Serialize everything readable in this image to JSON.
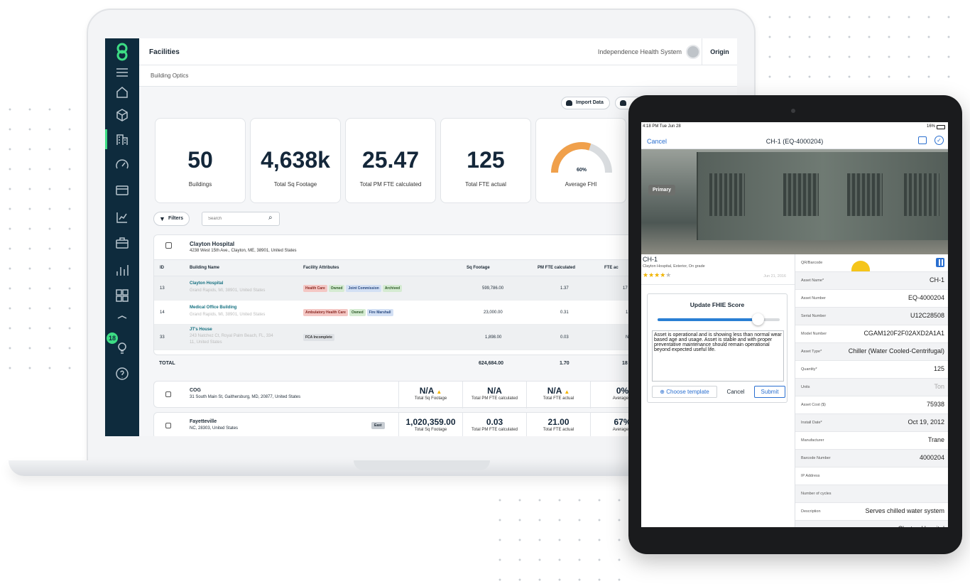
{
  "laptop": {
    "topbar": {
      "title": "Facilities",
      "org": "Independence Health System",
      "origin": "Origin"
    },
    "subbar": {
      "label": "Building Optics"
    },
    "actions": {
      "import": "Import Data"
    },
    "cards": [
      {
        "value": "50",
        "label": "Buildings"
      },
      {
        "value": "4,638k",
        "label": "Total Sq Footage"
      },
      {
        "value": "25.47",
        "label": "Total PM FTE calculated"
      },
      {
        "value": "125",
        "label": "Total FTE actual"
      },
      {
        "value": "60%",
        "label": "Average FHI",
        "gauge_fraction": 0.6
      }
    ],
    "filters": {
      "label": "Filters",
      "search_placeholder": "Search"
    },
    "sidebar": {
      "badge": "18"
    },
    "group1": {
      "name": "Clayton Hospital",
      "address": "4238 West 15th Ave., Clayton, ME, 38901, United States",
      "columns": [
        "ID",
        "Building Name",
        "Facility Attributes",
        "Sq Footage",
        "PM FTE calculated",
        "FTE ac"
      ],
      "rows": [
        {
          "id": "13",
          "name": "Clayton Hospital",
          "addr": "Grand Rapids, MI, 38901, United States",
          "tags": [
            "Health Care",
            "Owned",
            "Joint Commission",
            "Archived"
          ],
          "sq": "599,786.00",
          "pm": "1.37",
          "fte": "17"
        },
        {
          "id": "14",
          "name": "Medical Office Building",
          "addr": "Grand Rapids, MI, 38901, United States",
          "tags": [
            "Ambulatory Health Care",
            "Owned",
            "Fire Marshall"
          ],
          "sq": "23,000.00",
          "pm": "0.31",
          "fte": "1."
        },
        {
          "id": "33",
          "name": "JT's House",
          "addr": "243 Natchez Ct, Royal Palm Beach, FL, 334",
          "addr2": "11, United States",
          "tags": [
            "FCA Incomplete"
          ],
          "sq": "1,898.00",
          "pm": "0.03",
          "fte": "N"
        }
      ],
      "total": {
        "label": "TOTAL",
        "sq": "624,684.00",
        "pm": "1.70",
        "fte": "18"
      }
    },
    "group2": {
      "name": "COG",
      "address": "31 South Main St, Gaithersburg, MD, 20877, United States",
      "metrics": [
        {
          "value": "N/A",
          "label": "Total Sq Footage"
        },
        {
          "value": "N/A",
          "label": "Total PM FTE calculated"
        },
        {
          "value": "N/A",
          "label": "Total FTE actual"
        },
        {
          "value": "0%",
          "label": "Average F"
        }
      ]
    },
    "group3": {
      "name": "Fayetteville",
      "address": "NC, 28303, United States",
      "tag": "East",
      "metrics": [
        {
          "value": "1,020,359.00",
          "label": "Total Sq Footage"
        },
        {
          "value": "0.03",
          "label": "Total PM FTE calculated"
        },
        {
          "value": "21.00",
          "label": "Total FTE actual"
        },
        {
          "value": "67%",
          "label": "Average F"
        }
      ]
    }
  },
  "tablet": {
    "status": {
      "time": "4:18 PM  Tue Jun 28",
      "battery": "16%"
    },
    "nav": {
      "cancel": "Cancel",
      "title": "CH-1 (EQ-4000204)"
    },
    "photo": {
      "badge": "Primary"
    },
    "asset": {
      "name": "CH-1",
      "sub": "Clayton Hospital, Exterior, On grade",
      "date": "Jun 21, 2016",
      "stars": "★★★★",
      "star_empty": "★",
      "rating": 4
    },
    "fhie": {
      "title": "Update FHIE Score",
      "slider_value": 0.82,
      "text": "Asset is operational and is showing less than normal wear based age and usage. Asset is stable and with proper preventative maintenance should remain operational beyond expected useful life.",
      "choose": "Choose template",
      "cancel": "Cancel",
      "submit": "Submit"
    },
    "fields": [
      {
        "k": "QR/Barcode",
        "v": ""
      },
      {
        "k": "Asset Name*",
        "v": "CH-1"
      },
      {
        "k": "Asset Number",
        "v": "EQ-4000204"
      },
      {
        "k": "Serial Number",
        "v": "U12C28508"
      },
      {
        "k": "Model Number",
        "v": "CGAM120F2F02AXD2A1A1"
      },
      {
        "k": "Asset Type*",
        "v": "Chiller (Water Cooled-Centrifugal)"
      },
      {
        "k": "Quantity*",
        "v": "125"
      },
      {
        "k": "Units",
        "v": "Ton"
      },
      {
        "k": "Asset Cost ($)",
        "v": "75938"
      },
      {
        "k": "Install Date*",
        "v": "Oct 19, 2012"
      },
      {
        "k": "Manufacturer",
        "v": "Trane"
      },
      {
        "k": "Barcode Number",
        "v": "4000204"
      },
      {
        "k": "IP Address",
        "v": ""
      },
      {
        "k": "Number of cycles",
        "v": ""
      },
      {
        "k": "Description",
        "v": "Serves chilled water system"
      },
      {
        "k": "Location*",
        "v": "Clayton Hospital"
      }
    ],
    "colors": {
      "accent": "#2a7fd4",
      "brand": "#3ddc84",
      "sidebar": "#0e2b3d",
      "gauge": "#f0a04b"
    }
  }
}
